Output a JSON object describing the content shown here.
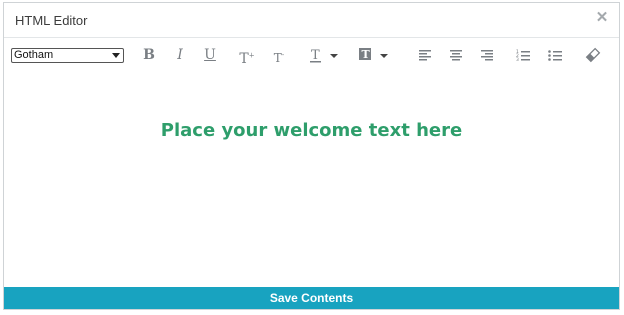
{
  "dialog": {
    "title": "HTML Editor",
    "close_icon": "close-icon"
  },
  "toolbar": {
    "font_value": "Gotham",
    "buttons": [
      {
        "name": "bold-button",
        "icon": "bold-icon"
      },
      {
        "name": "italic-button",
        "icon": "italic-icon"
      },
      {
        "name": "underline-button",
        "icon": "underline-icon"
      },
      {
        "name": "superscript-button",
        "icon": "superscript-icon"
      },
      {
        "name": "subscript-button",
        "icon": "subscript-icon"
      },
      {
        "name": "text-color-button",
        "icon": "text-color-icon"
      },
      {
        "name": "background-color-button",
        "icon": "background-color-icon"
      },
      {
        "name": "align-left-button",
        "icon": "align-left-icon"
      },
      {
        "name": "align-center-button",
        "icon": "align-center-icon"
      },
      {
        "name": "align-right-button",
        "icon": "align-right-icon"
      },
      {
        "name": "ordered-list-button",
        "icon": "ordered-list-icon"
      },
      {
        "name": "unordered-list-button",
        "icon": "unordered-list-icon"
      },
      {
        "name": "clear-format-button",
        "icon": "eraser-icon"
      }
    ]
  },
  "editor": {
    "content": "Place your welcome text here",
    "content_color": "#2e9e6b"
  },
  "footer": {
    "save_label": "Save Contents",
    "save_color": "#18a3c0"
  }
}
